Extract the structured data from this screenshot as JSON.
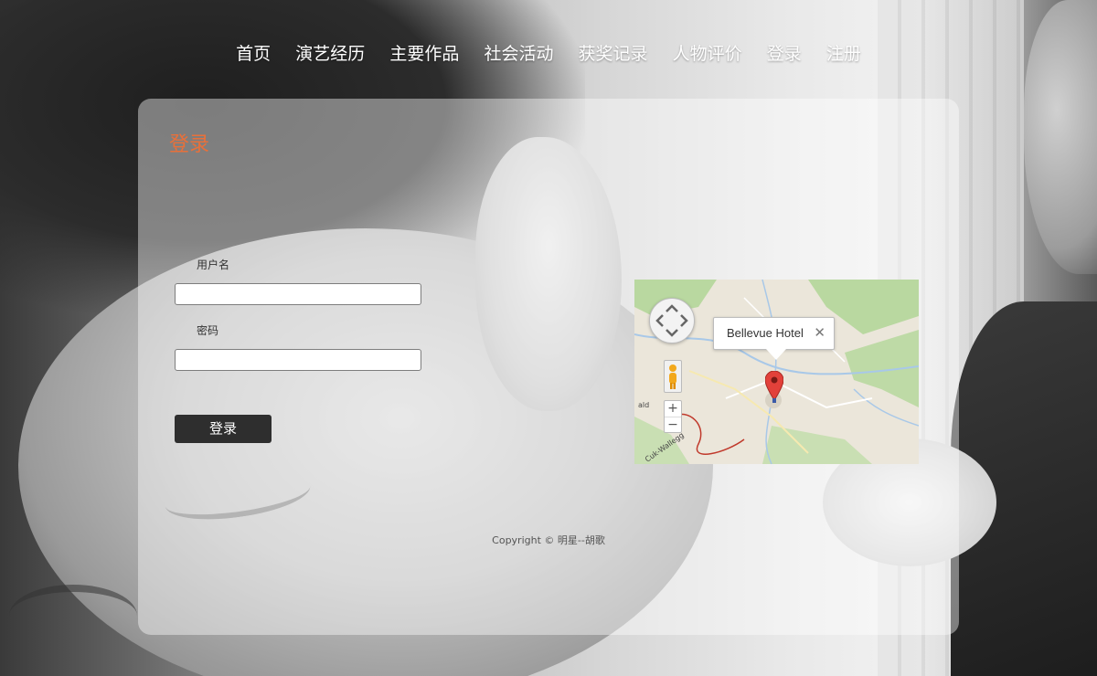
{
  "nav": {
    "items": [
      {
        "label": "首页"
      },
      {
        "label": "演艺经历"
      },
      {
        "label": "主要作品"
      },
      {
        "label": "社会活动"
      },
      {
        "label": "获奖记录"
      },
      {
        "label": "人物评价"
      },
      {
        "label": "登录"
      },
      {
        "label": "注册"
      }
    ]
  },
  "login": {
    "title": "登录",
    "username_label": "用户名",
    "username_value": "",
    "password_label": "密码",
    "password_value": "",
    "submit_label": "登录"
  },
  "map": {
    "info_title": "Bellevue Hotel",
    "close_glyph": "✕",
    "zoom_in": "+",
    "zoom_out": "−",
    "pin_color": "#e2413a",
    "water_color": "#a8c8e8",
    "park_color": "#b9d8a0"
  },
  "footer": {
    "copyright": "Copyright © 明星--胡歌"
  },
  "colors": {
    "accent": "#e8703a",
    "button_bg": "#2e2e2e"
  }
}
